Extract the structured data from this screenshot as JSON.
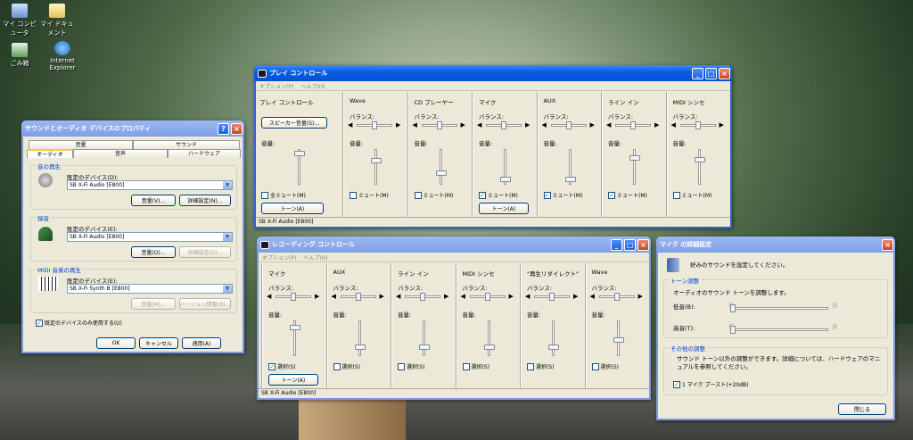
{
  "desktop": {
    "icons": [
      {
        "label": "マイ コンピュータ"
      },
      {
        "label": "マイ ドキュメント"
      },
      {
        "label": "ごみ箱"
      },
      {
        "label": "Internet Explorer"
      }
    ]
  },
  "sound_props": {
    "title": "サウンドとオーディオ デバイスのプロパティ",
    "tabs_top": [
      "音量",
      "サウンド"
    ],
    "tabs_bottom": [
      "オーディオ",
      "音声",
      "ハードウェア"
    ],
    "playback": {
      "group": "音の再生",
      "device_label": "既定のデバイス(D):",
      "device": "SB X-Fi Audio [E800]",
      "volume_btn": "音量(V)...",
      "advanced_btn": "詳細設定(N)..."
    },
    "recording": {
      "group": "録音",
      "device_label": "既定のデバイス(E):",
      "device": "SB X-Fi Audio [E800]",
      "volume_btn": "音量(O)...",
      "advanced_btn": "詳細設定(D)..."
    },
    "midi": {
      "group": "MIDI 音楽の再生",
      "device_label": "既定のデバイス(E):",
      "device": "SB X-Fi Synth B [E800]",
      "volume_btn": "音量(M)...",
      "about_btn": "バージョン情報(B)..."
    },
    "only_default": "既定のデバイスのみ使用する(U)",
    "ok": "OK",
    "cancel": "キャンセル",
    "apply": "適用(A)"
  },
  "play_ctrl": {
    "title": "プレイ コントロール",
    "menu": [
      "オプション(P)",
      "ヘルプ(H)"
    ],
    "master": {
      "name": "プレイ コントロール",
      "speaker_btn": "スピーカー音量(S)...",
      "volume": "音量:",
      "mute": "全ミュート(M)",
      "tone": "トーン(A)"
    },
    "balance": "バランス:",
    "volume": "音量:",
    "channels": [
      {
        "name": "Wave",
        "mute": "ミュート(M)",
        "muted": false,
        "level": 0.7
      },
      {
        "name": "CD プレーヤー",
        "mute": "ミュート(M)",
        "muted": false,
        "level": 0.3
      },
      {
        "name": "マイク",
        "mute": "ミュート(M)",
        "muted": true,
        "level": 0.1,
        "tone": "トーン(A)"
      },
      {
        "name": "AUX",
        "mute": "ミュート(M)",
        "muted": true,
        "level": 0.1
      },
      {
        "name": "ライン イン",
        "mute": "ミュート(M)",
        "muted": true,
        "level": 0.8
      },
      {
        "name": "MIDI シンセ",
        "mute": "ミュート(M)",
        "muted": false,
        "level": 0.75
      }
    ],
    "status": "SB X-Fi Audio [E800]"
  },
  "rec_ctrl": {
    "title": "レコーディング コントロール",
    "menu": [
      "オプション(P)",
      "ヘルプ(H)"
    ],
    "balance": "バランス:",
    "volume": "音量:",
    "channels": [
      {
        "name": "マイク",
        "select": "選択(S)",
        "selected": true,
        "level": 0.85,
        "tone": "トーン(A)"
      },
      {
        "name": "AUX",
        "select": "選択(S)",
        "selected": false,
        "level": 0.2
      },
      {
        "name": "ライン イン",
        "select": "選択(S)",
        "selected": false,
        "level": 0.2
      },
      {
        "name": "MIDI シンセ",
        "select": "選択(S)",
        "selected": false,
        "level": 0.2
      },
      {
        "name": "\"再生リダイレクト\"",
        "select": "選択(S)",
        "selected": false,
        "level": 0.2
      },
      {
        "name": "Wave",
        "select": "選択(S)",
        "selected": false,
        "level": 0.45
      }
    ],
    "status": "SB X-Fi Audio [E800]"
  },
  "mic_adv": {
    "title": "マイク の詳細設定",
    "intro": "好みのサウンドを設定してください。",
    "tone_group": "トーン調整",
    "tone_desc": "オーディオのサウンド トーンを調整します。",
    "bass": "低音(B):",
    "treble": "高音(T):",
    "low": "低",
    "high": "高",
    "bass_level": 0,
    "treble_level": 0,
    "other_group": "その他の調整",
    "other_desc": "サウンド トーン以外の調整ができます。詳細については、ハードウェアのマニュアルを参照してください。",
    "boost": "1 マイク ブースト(+20dB)",
    "boost_on": true,
    "close": "閉じる"
  }
}
